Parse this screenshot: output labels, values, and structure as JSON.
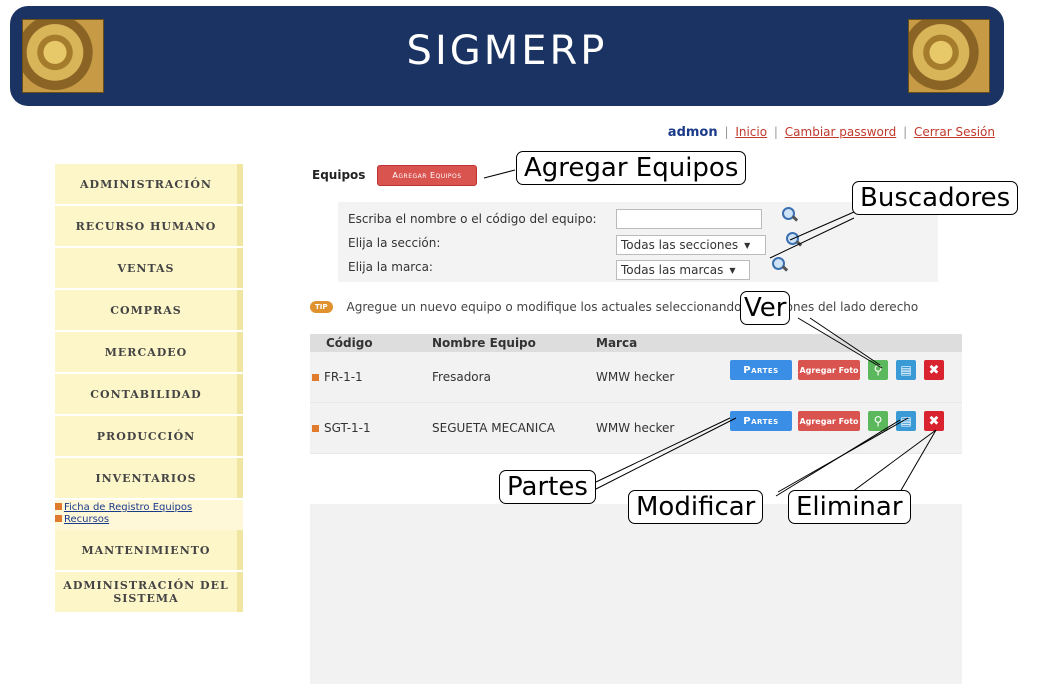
{
  "app": {
    "title": "SIGMERP"
  },
  "userbar": {
    "user": "admon",
    "links": [
      "Inicio",
      "Cambiar password",
      "Cerrar Sesión"
    ]
  },
  "sidebar": {
    "items": [
      "Administración",
      "Recurso Humano",
      "Ventas",
      "Compras",
      "Mercadeo",
      "Contabilidad",
      "Producción",
      "Inventarios"
    ],
    "submenu": [
      "Ficha de Registro Equipos",
      "Recursos"
    ],
    "items_after": [
      "Mantenimiento",
      "Administración Del Sistema"
    ]
  },
  "main": {
    "title": "Equipos",
    "add_button": "Agregar Equipos",
    "search": {
      "name_label": "Escriba el nombre o el código del equipo:",
      "name_value": "",
      "section_label": "Elija la sección:",
      "section_value": "Todas las secciones",
      "brand_label": "Elija la marca:",
      "brand_value": "Todas las marcas"
    },
    "tip_badge": "TIP",
    "tip_text": "Agregue un nuevo equipo o modifique los actuales seleccionando los botones del lado derecho",
    "table": {
      "headers": [
        "Código",
        "Nombre Equipo",
        "Marca"
      ],
      "rows": [
        {
          "code": "FR-1-1",
          "name": "Fresadora",
          "brand": "WMW hecker"
        },
        {
          "code": "SGT-1-1",
          "name": "SEGUETA MECANICA",
          "brand": "WMW hecker"
        }
      ],
      "partes_label": "Partes",
      "foto_label": "Agregar Foto"
    }
  },
  "callouts": {
    "agregar": "Agregar Equipos",
    "buscadores": "Buscadores",
    "ver": "Ver",
    "partes": "Partes",
    "modificar": "Modificar",
    "eliminar": "Eliminar"
  },
  "colors": {
    "banner": "#1a3362",
    "menu": "#fdf6c9",
    "red_button": "#d9534f",
    "blue_button": "#3a8ee6"
  }
}
